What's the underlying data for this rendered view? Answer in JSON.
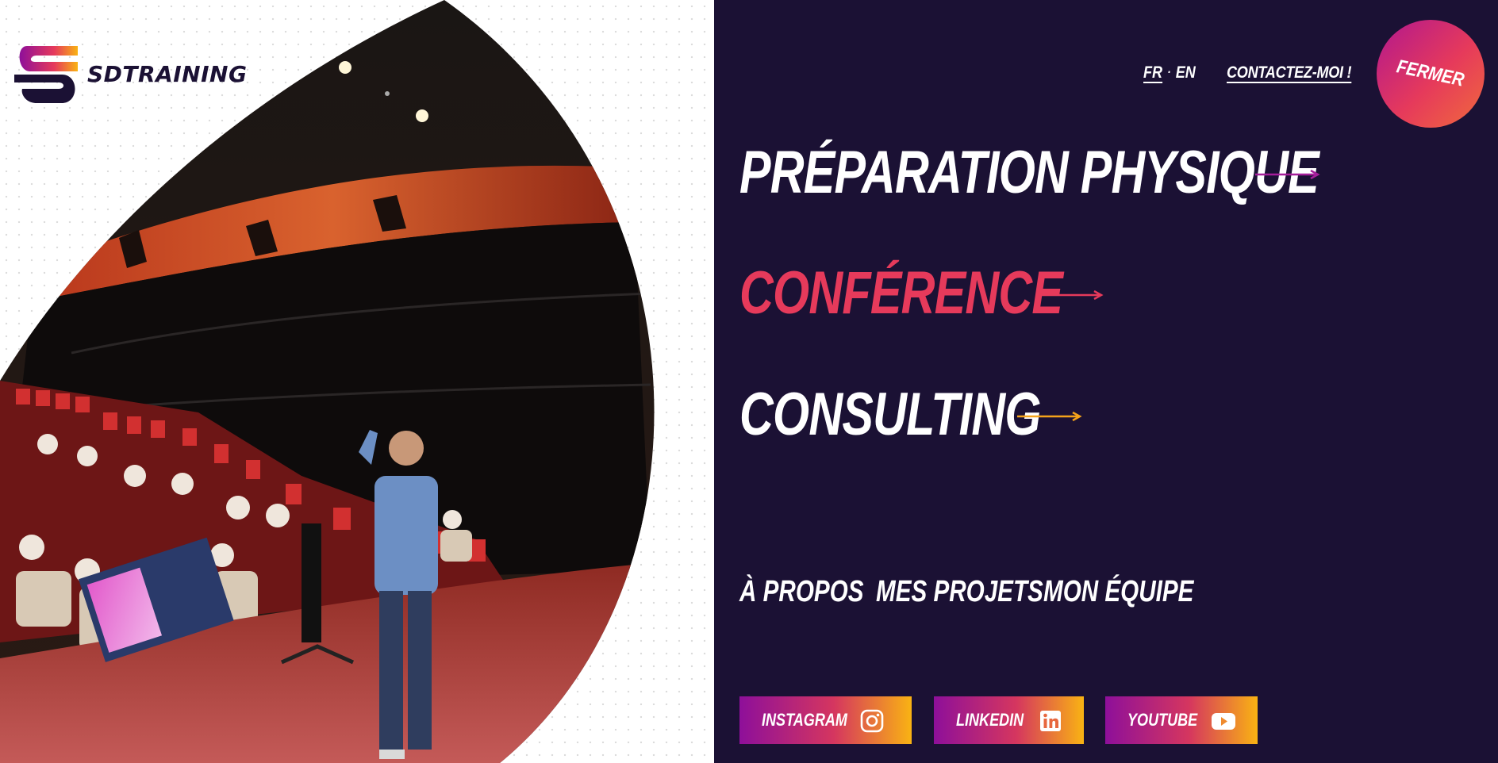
{
  "brand": {
    "name": "SDTRAINING"
  },
  "header": {
    "languages": [
      {
        "code": "FR",
        "active": true
      },
      {
        "code": "EN",
        "active": false
      }
    ],
    "lang_separator": "·",
    "contact_label": "CONTACTEZ-MOI !",
    "close_label": "FERMER"
  },
  "main_menu": {
    "items": [
      {
        "label": "PRÉPARATION PHYSIQUE",
        "color": "#ffffff",
        "arrow_color": "#a51e9a"
      },
      {
        "label": "CONFÉRENCE",
        "color": "#e63a5b",
        "arrow_color": "#e63a5b"
      },
      {
        "label": "CONSULTING",
        "color": "#ffffff",
        "arrow_color": "#f5a31a"
      }
    ]
  },
  "secondary_menu": {
    "items": [
      {
        "label": "À PROPOS"
      },
      {
        "label": "MES PROJETS"
      },
      {
        "label": "MON ÉQUIPE"
      }
    ]
  },
  "social": {
    "items": [
      {
        "label": "INSTAGRAM",
        "icon": "instagram-icon"
      },
      {
        "label": "LINKEDIN",
        "icon": "linkedin-icon"
      },
      {
        "label": "YOUTUBE",
        "icon": "youtube-icon"
      }
    ]
  },
  "colors": {
    "background": "#1b1134",
    "accent_pink": "#e63a5b",
    "accent_purple": "#8e0f9a",
    "accent_orange": "#f9b313"
  },
  "hero_image": {
    "subject": "speaker-on-stage-icon"
  }
}
